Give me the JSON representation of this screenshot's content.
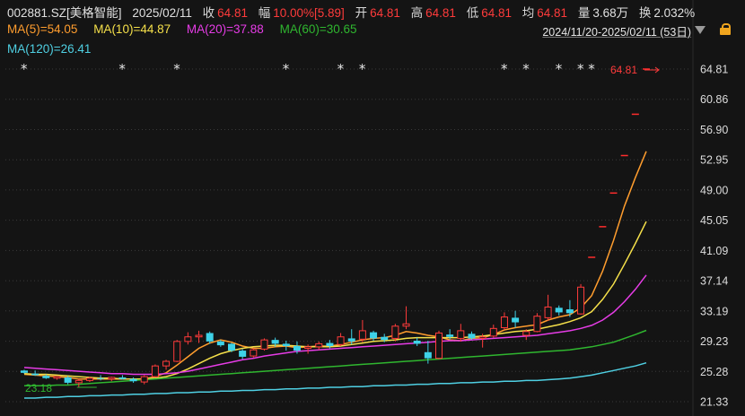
{
  "header": {
    "symbol": "002881.SZ[美格智能]",
    "date": "2025/02/11",
    "close_label": "收",
    "close": "64.81",
    "change_label": "幅",
    "change": "10.00%[5.89]",
    "open_label": "开",
    "open": "64.81",
    "high_label": "高",
    "high": "64.81",
    "low_label": "低",
    "low": "64.81",
    "avg_label": "均",
    "avg": "64.81",
    "volume_label": "量",
    "volume": "3.68万",
    "turnover_label": "换",
    "turnover": "2.032%"
  },
  "ma_legend": [
    {
      "label": "MA(5)=54.05",
      "color": "#ff9d2e"
    },
    {
      "label": "MA(10)=44.87",
      "color": "#f5e04a"
    },
    {
      "label": "MA(20)=37.88",
      "color": "#e63ce6"
    },
    {
      "label": "MA(60)=30.65",
      "color": "#2fb62f"
    },
    {
      "label": "MA(120)=26.41",
      "color": "#4fd0e3"
    }
  ],
  "range": "2024/11/20-2025/02/11 (53日)",
  "colors": {
    "up": "#ff3b3b",
    "down": "#3ed2e8",
    "limit": "#ff2d2d",
    "grid": "#3a3a3a",
    "axis_text": "#dddddd"
  },
  "chart_data": {
    "type": "candlestick",
    "ylim": [
      21.33,
      66.0
    ],
    "y_ticks": [
      "64.81",
      "60.86",
      "56.90",
      "52.95",
      "49.00",
      "45.05",
      "41.09",
      "37.14",
      "33.19",
      "29.23",
      "25.28",
      "21.33"
    ],
    "last_price_label": "64.81",
    "low_label": "23.18",
    "star_markers": [
      0,
      9,
      14,
      24,
      29,
      31,
      44,
      46,
      49,
      51,
      52
    ],
    "ohlc": [
      [
        25.4,
        25.5,
        25.0,
        25.1
      ],
      [
        25.0,
        25.4,
        24.7,
        24.8
      ],
      [
        24.7,
        24.9,
        24.3,
        24.4
      ],
      [
        24.4,
        24.7,
        24.2,
        24.6
      ],
      [
        24.5,
        24.7,
        23.6,
        23.8
      ],
      [
        23.8,
        24.3,
        23.2,
        24.1
      ],
      [
        24.1,
        24.6,
        23.9,
        24.4
      ],
      [
        24.4,
        24.8,
        24.1,
        24.3
      ],
      [
        24.3,
        24.6,
        24.0,
        24.5
      ],
      [
        24.5,
        24.8,
        24.2,
        24.3
      ],
      [
        24.3,
        24.5,
        23.8,
        24.0
      ],
      [
        23.9,
        24.8,
        23.6,
        24.6
      ],
      [
        24.6,
        26.2,
        24.5,
        26.0
      ],
      [
        26.0,
        26.8,
        25.5,
        26.6
      ],
      [
        26.6,
        29.4,
        26.5,
        29.2
      ],
      [
        29.2,
        30.4,
        28.8,
        29.8
      ],
      [
        29.8,
        30.6,
        29.0,
        30.0
      ],
      [
        30.3,
        30.5,
        28.9,
        29.2
      ],
      [
        29.2,
        29.4,
        28.5,
        28.7
      ],
      [
        28.9,
        29.0,
        27.8,
        28.0
      ],
      [
        28.0,
        28.2,
        26.9,
        27.2
      ],
      [
        27.3,
        28.3,
        27.1,
        28.1
      ],
      [
        28.2,
        29.6,
        28.0,
        29.4
      ],
      [
        29.4,
        29.7,
        28.5,
        28.9
      ],
      [
        28.9,
        29.3,
        28.0,
        28.6
      ],
      [
        28.6,
        29.2,
        27.6,
        28.0
      ],
      [
        28.3,
        28.8,
        27.6,
        28.5
      ],
      [
        28.5,
        29.2,
        28.1,
        28.9
      ],
      [
        29.0,
        29.4,
        28.3,
        28.6
      ],
      [
        28.8,
        30.3,
        28.6,
        29.8
      ],
      [
        29.6,
        30.8,
        28.8,
        29.2
      ],
      [
        29.5,
        32.0,
        29.1,
        30.6
      ],
      [
        30.4,
        30.6,
        29.3,
        29.6
      ],
      [
        29.8,
        30.2,
        29.1,
        29.4
      ],
      [
        29.6,
        31.5,
        29.2,
        31.2
      ],
      [
        31.2,
        33.8,
        30.8,
        31.5
      ],
      [
        29.3,
        29.7,
        28.6,
        28.9
      ],
      [
        27.8,
        29.3,
        26.3,
        27.0
      ],
      [
        27.0,
        30.6,
        26.9,
        30.3
      ],
      [
        30.1,
        30.8,
        29.5,
        29.8
      ],
      [
        29.6,
        31.5,
        29.2,
        30.6
      ],
      [
        30.2,
        30.5,
        29.4,
        29.6
      ],
      [
        29.6,
        30.2,
        28.4,
        29.8
      ],
      [
        29.9,
        31.4,
        29.7,
        30.9
      ],
      [
        31.0,
        33.0,
        30.7,
        32.4
      ],
      [
        32.3,
        33.2,
        31.0,
        31.7
      ],
      [
        30.0,
        30.8,
        29.4,
        30.5
      ],
      [
        30.5,
        32.9,
        30.4,
        32.5
      ],
      [
        32.3,
        35.3,
        31.9,
        33.7
      ],
      [
        33.6,
        33.9,
        32.6,
        33.0
      ],
      [
        33.4,
        34.6,
        32.4,
        32.9
      ],
      [
        32.8,
        36.7,
        32.7,
        36.3
      ],
      [
        40.2,
        40.2,
        40.2,
        40.2
      ],
      [
        44.2,
        44.2,
        44.2,
        44.2
      ],
      [
        48.6,
        48.6,
        48.6,
        48.6
      ],
      [
        53.5,
        53.5,
        53.5,
        53.5
      ],
      [
        58.9,
        58.9,
        58.9,
        58.9
      ],
      [
        64.81,
        64.81,
        64.81,
        64.81
      ]
    ],
    "ma5": [
      24.9,
      24.8,
      24.7,
      24.6,
      24.5,
      24.3,
      24.3,
      24.3,
      24.3,
      24.3,
      24.3,
      24.3,
      24.6,
      25.1,
      26.1,
      27.2,
      28.3,
      29.0,
      29.4,
      29.1,
      28.6,
      28.3,
      28.3,
      28.5,
      28.6,
      28.4,
      28.5,
      28.6,
      28.6,
      28.8,
      29.1,
      29.4,
      29.6,
      29.7,
      30.0,
      30.5,
      30.3,
      30.0,
      29.8,
      29.4,
      29.3,
      29.6,
      29.7,
      30.1,
      30.7,
      31.0,
      31.2,
      31.4,
      32.0,
      32.4,
      32.7,
      33.6,
      35.2,
      38.4,
      42.4,
      46.9,
      50.6,
      54.05
    ],
    "ma10": [
      25.0,
      24.9,
      24.9,
      24.8,
      24.7,
      24.6,
      24.5,
      24.4,
      24.4,
      24.3,
      24.3,
      24.3,
      24.4,
      24.6,
      25.0,
      25.6,
      26.3,
      27.0,
      27.6,
      28.0,
      28.3,
      28.5,
      28.6,
      28.7,
      28.7,
      28.6,
      28.5,
      28.5,
      28.5,
      28.6,
      28.8,
      29.0,
      29.2,
      29.3,
      29.4,
      29.6,
      29.7,
      29.7,
      29.7,
      29.7,
      29.7,
      29.8,
      29.9,
      30.1,
      30.3,
      30.5,
      30.6,
      30.8,
      31.1,
      31.4,
      31.8,
      32.3,
      33.1,
      34.7,
      36.7,
      39.3,
      42.0,
      44.87
    ],
    "ma20": [
      25.8,
      25.7,
      25.6,
      25.5,
      25.4,
      25.3,
      25.2,
      25.1,
      25.0,
      25.0,
      24.9,
      24.9,
      24.9,
      25.0,
      25.1,
      25.3,
      25.6,
      25.9,
      26.2,
      26.5,
      26.8,
      27.0,
      27.3,
      27.5,
      27.7,
      27.9,
      28.0,
      28.1,
      28.2,
      28.3,
      28.4,
      28.5,
      28.6,
      28.7,
      28.8,
      28.9,
      29.0,
      29.1,
      29.2,
      29.3,
      29.3,
      29.4,
      29.5,
      29.6,
      29.7,
      29.8,
      29.9,
      30.0,
      30.2,
      30.4,
      30.6,
      30.9,
      31.3,
      32.0,
      33.0,
      34.4,
      36.0,
      37.88
    ],
    "ma60": [
      23.4,
      23.4,
      23.4,
      23.5,
      23.5,
      23.6,
      23.7,
      23.8,
      23.9,
      24.0,
      24.1,
      24.2,
      24.3,
      24.4,
      24.5,
      24.6,
      24.7,
      24.8,
      24.9,
      25.0,
      25.1,
      25.2,
      25.3,
      25.4,
      25.5,
      25.6,
      25.7,
      25.8,
      25.9,
      26.0,
      26.1,
      26.2,
      26.3,
      26.4,
      26.5,
      26.6,
      26.7,
      26.8,
      26.9,
      27.0,
      27.1,
      27.2,
      27.3,
      27.4,
      27.5,
      27.6,
      27.7,
      27.8,
      27.9,
      28.0,
      28.1,
      28.3,
      28.5,
      28.8,
      29.1,
      29.6,
      30.1,
      30.65
    ],
    "ma120": [
      21.8,
      21.8,
      21.9,
      21.9,
      22.0,
      22.0,
      22.1,
      22.1,
      22.2,
      22.2,
      22.3,
      22.3,
      22.4,
      22.4,
      22.5,
      22.5,
      22.6,
      22.6,
      22.7,
      22.7,
      22.8,
      22.8,
      22.9,
      22.9,
      23.0,
      23.0,
      23.1,
      23.1,
      23.2,
      23.2,
      23.3,
      23.3,
      23.4,
      23.4,
      23.5,
      23.5,
      23.6,
      23.6,
      23.7,
      23.7,
      23.8,
      23.8,
      23.9,
      23.9,
      24.0,
      24.0,
      24.1,
      24.1,
      24.2,
      24.3,
      24.4,
      24.6,
      24.8,
      25.1,
      25.4,
      25.7,
      26.0,
      26.41
    ]
  }
}
